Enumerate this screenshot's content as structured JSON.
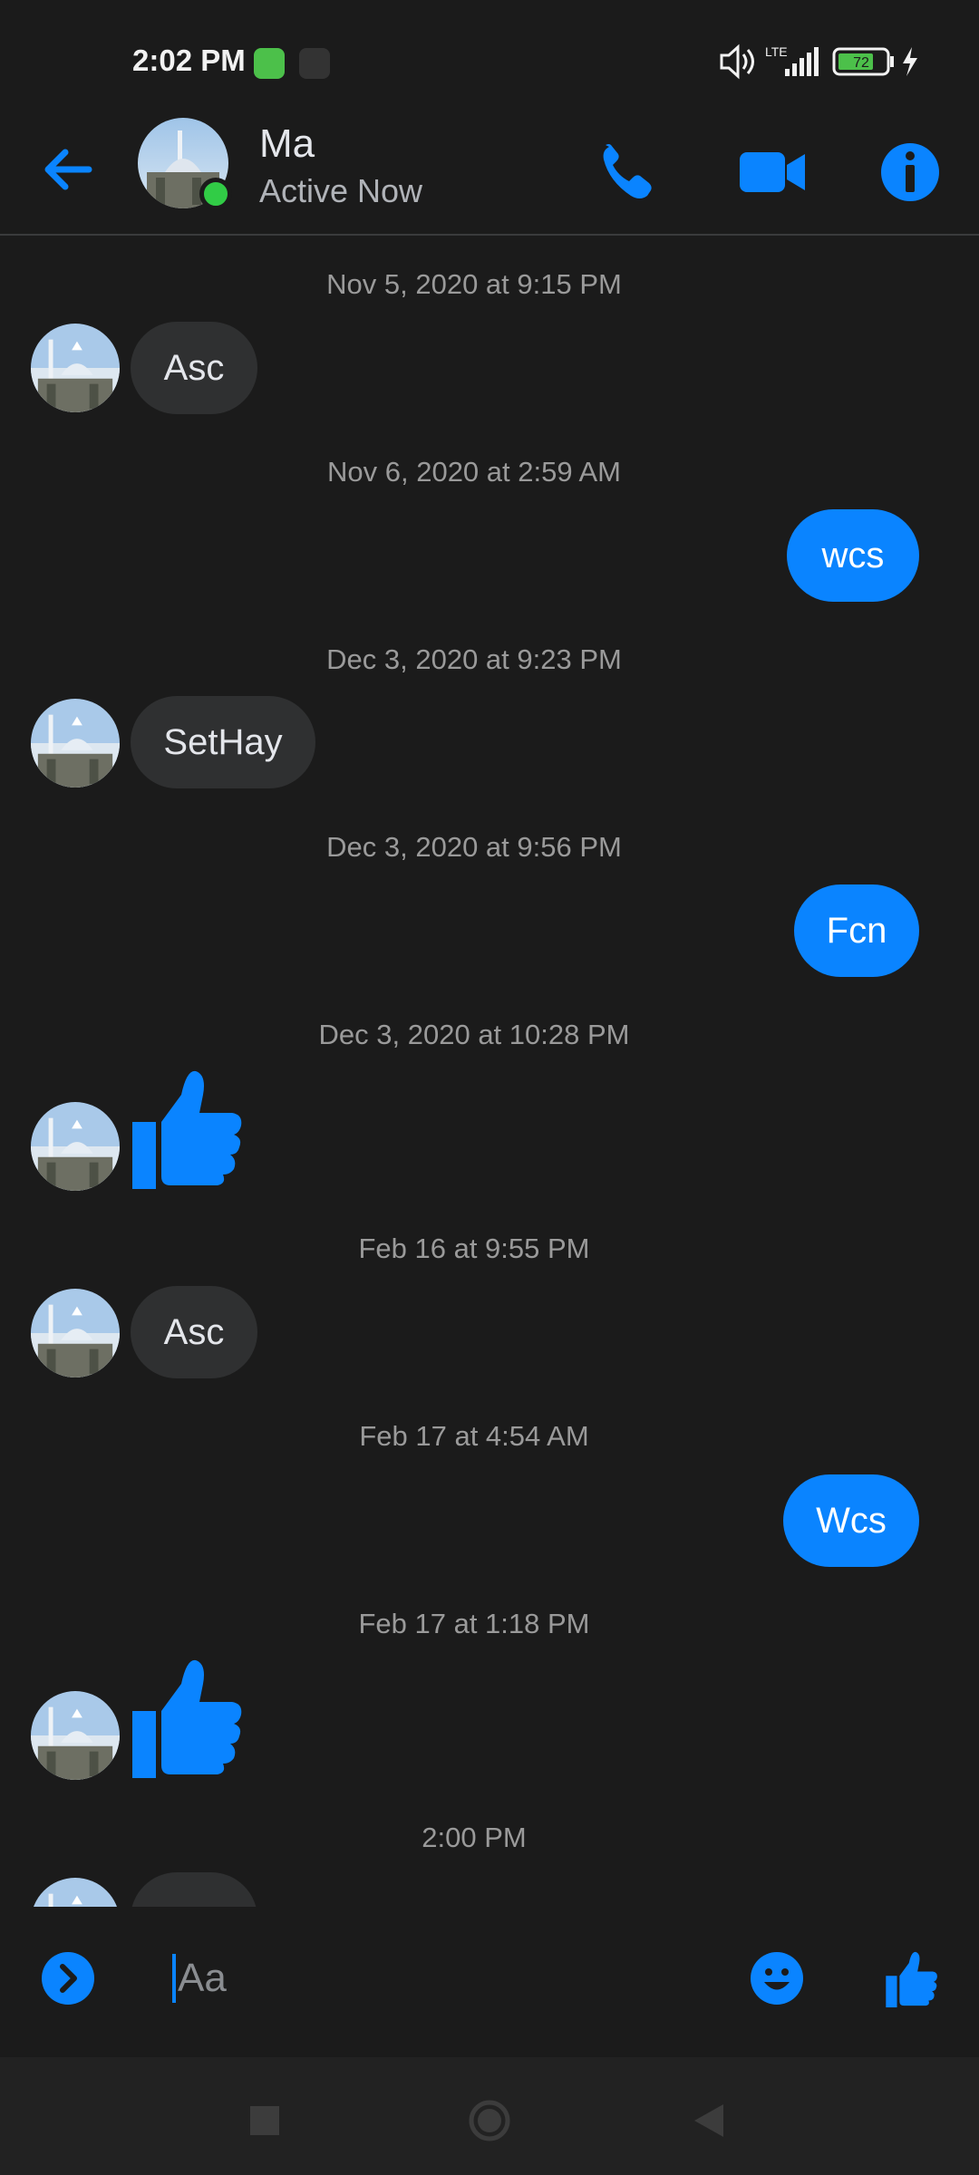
{
  "status_bar": {
    "time": "2:02 PM",
    "network": "LTE",
    "battery": "72"
  },
  "header": {
    "contact_name": "Ma",
    "contact_status": "Active Now",
    "icons": [
      "back-arrow-icon",
      "phone-icon",
      "video-camera-icon",
      "info-icon"
    ]
  },
  "messages": [
    {
      "type": "timestamp",
      "text": "Nov 5, 2020 at 9:15 PM"
    },
    {
      "type": "in",
      "text": "Asc"
    },
    {
      "type": "timestamp",
      "text": "Nov 6, 2020 at 2:59 AM"
    },
    {
      "type": "out",
      "text": "wcs"
    },
    {
      "type": "timestamp",
      "text": "Dec 3, 2020 at 9:23 PM"
    },
    {
      "type": "in",
      "text": "SetHay"
    },
    {
      "type": "timestamp",
      "text": "Dec 3, 2020 at 9:56 PM"
    },
    {
      "type": "out",
      "text": "Fcn"
    },
    {
      "type": "timestamp",
      "text": "Dec 3, 2020 at 10:28 PM"
    },
    {
      "type": "in-like",
      "icon": "thumbs-up-icon"
    },
    {
      "type": "timestamp",
      "text": "Feb 16 at 9:55 PM"
    },
    {
      "type": "in",
      "text": "Asc"
    },
    {
      "type": "timestamp",
      "text": "Feb 17 at 4:54 AM"
    },
    {
      "type": "out",
      "text": "Wcs"
    },
    {
      "type": "timestamp",
      "text": "Feb 17 at 1:18 PM"
    },
    {
      "type": "in-like",
      "icon": "thumbs-up-icon"
    },
    {
      "type": "timestamp",
      "text": "2:00 PM"
    }
  ],
  "composer": {
    "placeholder": "Aa",
    "icons": [
      "expand-chevron-icon",
      "emoji-icon",
      "thumbs-up-icon"
    ]
  },
  "colors": {
    "accent": "#0a84ff",
    "background": "#1b1b1b",
    "incoming_bubble": "#2f3031",
    "online": "#31cc46"
  }
}
